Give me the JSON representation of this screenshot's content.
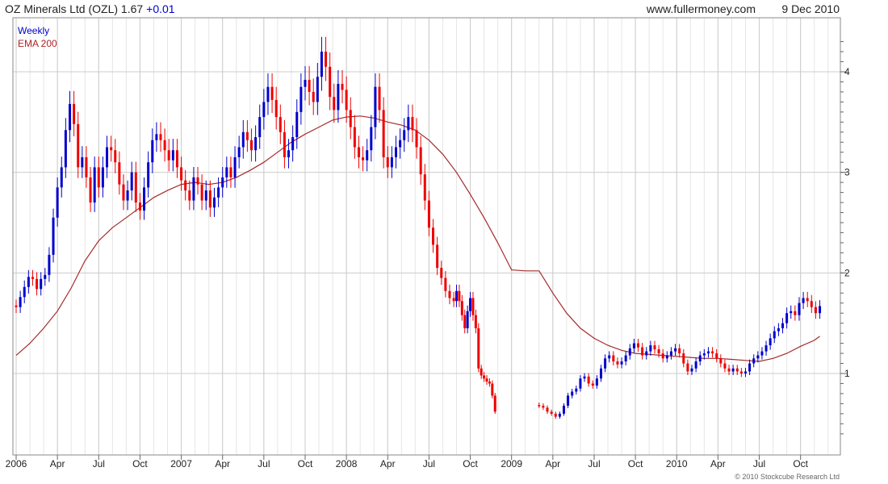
{
  "header": {
    "title": "OZ Minerals Ltd (OZL) 1.67",
    "change": "+0.01",
    "site": "www.fullermoney.com",
    "date": "9 Dec 2010"
  },
  "legend": {
    "weekly": "Weekly",
    "ema": "EMA 200"
  },
  "copyright": "© 2010 Stockcube Research Ltd",
  "colors": {
    "up": "#0000cc",
    "down": "#ee0000",
    "ema": "#a52a2a",
    "grid": "#cccccc",
    "frame": "#888888"
  },
  "chart_data": {
    "type": "candlestick",
    "x_tick_labels": [
      "2006",
      "Apr",
      "Jul",
      "Oct",
      "2007",
      "Apr",
      "Jul",
      "Oct",
      "2008",
      "Apr",
      "Jul",
      "Oct",
      "2009",
      "Apr",
      "Jul",
      "Oct",
      "2010",
      "Apr",
      "Jul",
      "Oct"
    ],
    "x_ticks_month_index": [
      0,
      3,
      6,
      9,
      12,
      15,
      18,
      21,
      24,
      27,
      30,
      33,
      36,
      39,
      42,
      45,
      48,
      51,
      54,
      57
    ],
    "xlim_months": [
      0,
      59.6
    ],
    "y_ticks": [
      1,
      2,
      3,
      4
    ],
    "ylim": [
      0.35,
      4.4
    ],
    "grid": true,
    "legend_position": "top-left",
    "series": [
      {
        "name": "Weekly",
        "values": [
          [
            0.0,
            1.66
          ],
          [
            0.3,
            1.76
          ],
          [
            0.6,
            1.86
          ],
          [
            0.9,
            1.96
          ],
          [
            1.2,
            1.94
          ],
          [
            1.5,
            1.84
          ],
          [
            1.8,
            1.94
          ],
          [
            2.1,
            1.98
          ],
          [
            2.4,
            2.18
          ],
          [
            2.7,
            2.55
          ],
          [
            3.0,
            2.85
          ],
          [
            3.3,
            3.05
          ],
          [
            3.6,
            3.42
          ],
          [
            3.9,
            3.68
          ],
          [
            4.2,
            3.48
          ],
          [
            4.5,
            3.05
          ],
          [
            4.8,
            3.15
          ],
          [
            5.1,
            2.95
          ],
          [
            5.4,
            2.7
          ],
          [
            5.7,
            3.05
          ],
          [
            6.0,
            2.85
          ],
          [
            6.3,
            3.05
          ],
          [
            6.6,
            3.25
          ],
          [
            6.9,
            3.22
          ],
          [
            7.2,
            3.1
          ],
          [
            7.5,
            2.88
          ],
          [
            7.8,
            2.72
          ],
          [
            8.1,
            2.82
          ],
          [
            8.4,
            3.0
          ],
          [
            8.7,
            2.7
          ],
          [
            9.0,
            2.62
          ],
          [
            9.3,
            2.85
          ],
          [
            9.6,
            3.1
          ],
          [
            9.9,
            3.32
          ],
          [
            10.2,
            3.38
          ],
          [
            10.5,
            3.32
          ],
          [
            10.8,
            3.22
          ],
          [
            11.1,
            3.12
          ],
          [
            11.4,
            3.22
          ],
          [
            11.7,
            3.05
          ],
          [
            12.0,
            2.92
          ],
          [
            12.3,
            2.82
          ],
          [
            12.6,
            2.72
          ],
          [
            12.9,
            2.95
          ],
          [
            13.2,
            2.88
          ],
          [
            13.5,
            2.72
          ],
          [
            13.8,
            2.82
          ],
          [
            14.1,
            2.65
          ],
          [
            14.4,
            2.75
          ],
          [
            14.7,
            2.85
          ],
          [
            15.0,
            2.95
          ],
          [
            15.3,
            3.05
          ],
          [
            15.6,
            2.95
          ],
          [
            15.9,
            3.15
          ],
          [
            16.2,
            3.25
          ],
          [
            16.5,
            3.4
          ],
          [
            16.8,
            3.32
          ],
          [
            17.1,
            3.22
          ],
          [
            17.4,
            3.35
          ],
          [
            17.7,
            3.55
          ],
          [
            18.0,
            3.7
          ],
          [
            18.3,
            3.85
          ],
          [
            18.6,
            3.72
          ],
          [
            18.9,
            3.55
          ],
          [
            19.2,
            3.4
          ],
          [
            19.5,
            3.15
          ],
          [
            19.8,
            3.22
          ],
          [
            20.1,
            3.35
          ],
          [
            20.4,
            3.6
          ],
          [
            20.7,
            3.85
          ],
          [
            21.0,
            3.92
          ],
          [
            21.3,
            3.8
          ],
          [
            21.6,
            3.7
          ],
          [
            21.9,
            3.95
          ],
          [
            22.2,
            4.2
          ],
          [
            22.5,
            4.05
          ],
          [
            22.8,
            3.75
          ],
          [
            23.1,
            3.62
          ],
          [
            23.4,
            3.88
          ],
          [
            23.7,
            3.82
          ],
          [
            24.0,
            3.62
          ],
          [
            24.3,
            3.45
          ],
          [
            24.6,
            3.25
          ],
          [
            24.9,
            3.15
          ],
          [
            25.2,
            3.12
          ],
          [
            25.5,
            3.22
          ],
          [
            25.8,
            3.45
          ],
          [
            26.1,
            3.85
          ],
          [
            26.4,
            3.62
          ],
          [
            26.7,
            3.15
          ],
          [
            27.0,
            3.05
          ],
          [
            27.3,
            3.15
          ],
          [
            27.6,
            3.25
          ],
          [
            27.9,
            3.32
          ],
          [
            28.2,
            3.42
          ],
          [
            28.5,
            3.55
          ],
          [
            28.8,
            3.42
          ],
          [
            29.1,
            3.25
          ],
          [
            29.4,
            2.98
          ],
          [
            29.7,
            2.72
          ],
          [
            30.0,
            2.45
          ],
          [
            30.3,
            2.28
          ],
          [
            30.6,
            2.05
          ],
          [
            30.9,
            1.95
          ],
          [
            31.2,
            1.82
          ],
          [
            31.5,
            1.75
          ],
          [
            31.8,
            1.72
          ],
          [
            32.0,
            1.82
          ],
          [
            32.2,
            1.72
          ],
          [
            32.4,
            1.58
          ],
          [
            32.6,
            1.45
          ],
          [
            32.8,
            1.62
          ],
          [
            33.0,
            1.75
          ],
          [
            33.2,
            1.58
          ],
          [
            33.4,
            1.45
          ],
          [
            33.6,
            1.05
          ],
          [
            33.8,
            0.98
          ],
          [
            34.0,
            0.95
          ],
          [
            34.2,
            0.92
          ],
          [
            34.4,
            0.9
          ],
          [
            34.6,
            0.78
          ],
          [
            34.8,
            0.62
          ],
          [
            38.0,
            0.68
          ],
          [
            38.3,
            0.66
          ],
          [
            38.6,
            0.62
          ],
          [
            38.9,
            0.6
          ],
          [
            39.2,
            0.57
          ],
          [
            39.5,
            0.6
          ],
          [
            39.8,
            0.68
          ],
          [
            40.1,
            0.78
          ],
          [
            40.4,
            0.82
          ],
          [
            40.7,
            0.85
          ],
          [
            41.0,
            0.95
          ],
          [
            41.3,
            0.97
          ],
          [
            41.6,
            0.9
          ],
          [
            41.9,
            0.88
          ],
          [
            42.2,
            0.95
          ],
          [
            42.5,
            1.05
          ],
          [
            42.8,
            1.15
          ],
          [
            43.1,
            1.18
          ],
          [
            43.4,
            1.12
          ],
          [
            43.7,
            1.09
          ],
          [
            44.0,
            1.12
          ],
          [
            44.3,
            1.18
          ],
          [
            44.6,
            1.25
          ],
          [
            44.9,
            1.3
          ],
          [
            45.2,
            1.26
          ],
          [
            45.5,
            1.18
          ],
          [
            45.8,
            1.22
          ],
          [
            46.1,
            1.28
          ],
          [
            46.4,
            1.24
          ],
          [
            46.7,
            1.2
          ],
          [
            47.0,
            1.15
          ],
          [
            47.3,
            1.18
          ],
          [
            47.6,
            1.22
          ],
          [
            47.9,
            1.25
          ],
          [
            48.2,
            1.2
          ],
          [
            48.5,
            1.1
          ],
          [
            48.8,
            1.02
          ],
          [
            49.1,
            1.05
          ],
          [
            49.4,
            1.12
          ],
          [
            49.7,
            1.18
          ],
          [
            50.0,
            1.2
          ],
          [
            50.3,
            1.22
          ],
          [
            50.6,
            1.2
          ],
          [
            50.9,
            1.15
          ],
          [
            51.2,
            1.1
          ],
          [
            51.5,
            1.05
          ],
          [
            51.8,
            1.02
          ],
          [
            52.1,
            1.05
          ],
          [
            52.4,
            1.02
          ],
          [
            52.7,
            1.0
          ],
          [
            53.0,
            1.02
          ],
          [
            53.3,
            1.1
          ],
          [
            53.6,
            1.15
          ],
          [
            53.9,
            1.18
          ],
          [
            54.2,
            1.22
          ],
          [
            54.5,
            1.28
          ],
          [
            54.8,
            1.35
          ],
          [
            55.1,
            1.42
          ],
          [
            55.4,
            1.45
          ],
          [
            55.7,
            1.5
          ],
          [
            56.0,
            1.6
          ],
          [
            56.3,
            1.62
          ],
          [
            56.6,
            1.58
          ],
          [
            56.9,
            1.7
          ],
          [
            57.2,
            1.75
          ],
          [
            57.5,
            1.72
          ],
          [
            57.8,
            1.66
          ],
          [
            58.1,
            1.6
          ],
          [
            58.4,
            1.67
          ]
        ]
      },
      {
        "name": "EMA 200",
        "values": [
          [
            0,
            1.18
          ],
          [
            1,
            1.3
          ],
          [
            2,
            1.45
          ],
          [
            3,
            1.62
          ],
          [
            4,
            1.85
          ],
          [
            5,
            2.12
          ],
          [
            6,
            2.32
          ],
          [
            7,
            2.45
          ],
          [
            8,
            2.55
          ],
          [
            9,
            2.65
          ],
          [
            10,
            2.75
          ],
          [
            11,
            2.82
          ],
          [
            12,
            2.88
          ],
          [
            13,
            2.9
          ],
          [
            14,
            2.88
          ],
          [
            15,
            2.9
          ],
          [
            16,
            2.95
          ],
          [
            17,
            3.02
          ],
          [
            18,
            3.1
          ],
          [
            19,
            3.2
          ],
          [
            20,
            3.3
          ],
          [
            21,
            3.38
          ],
          [
            22,
            3.45
          ],
          [
            23,
            3.52
          ],
          [
            24,
            3.55
          ],
          [
            25,
            3.56
          ],
          [
            26,
            3.54
          ],
          [
            27,
            3.5
          ],
          [
            28,
            3.47
          ],
          [
            29,
            3.42
          ],
          [
            30,
            3.32
          ],
          [
            31,
            3.18
          ],
          [
            32,
            3.0
          ],
          [
            33,
            2.78
          ],
          [
            34,
            2.55
          ],
          [
            35,
            2.3
          ],
          [
            36,
            2.03
          ],
          [
            37,
            2.02
          ],
          [
            38,
            2.02
          ],
          [
            39,
            1.8
          ],
          [
            40,
            1.6
          ],
          [
            41,
            1.45
          ],
          [
            42,
            1.35
          ],
          [
            43,
            1.28
          ],
          [
            44,
            1.23
          ],
          [
            45,
            1.2
          ],
          [
            46,
            1.19
          ],
          [
            47,
            1.18
          ],
          [
            48,
            1.17
          ],
          [
            49,
            1.16
          ],
          [
            50,
            1.15
          ],
          [
            51,
            1.15
          ],
          [
            52,
            1.14
          ],
          [
            53,
            1.13
          ],
          [
            54,
            1.12
          ],
          [
            55,
            1.15
          ],
          [
            56,
            1.2
          ],
          [
            57,
            1.27
          ],
          [
            58,
            1.33
          ],
          [
            58.4,
            1.37
          ]
        ]
      }
    ]
  }
}
